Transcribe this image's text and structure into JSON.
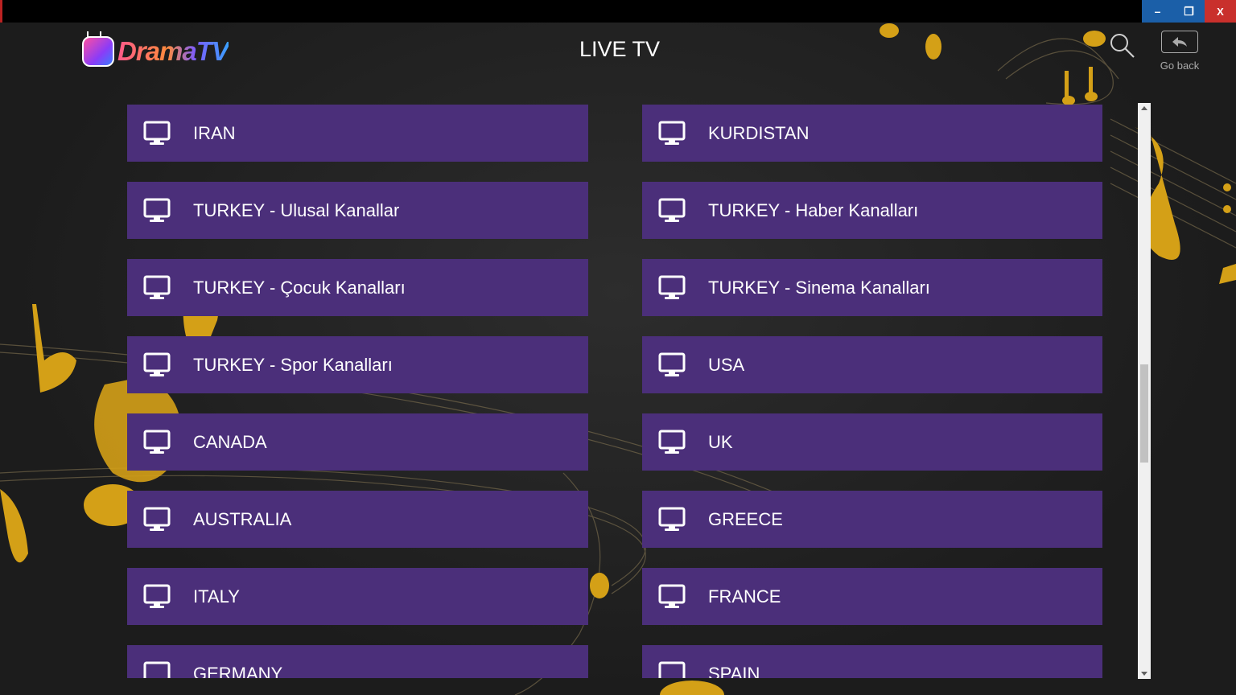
{
  "window": {
    "minimize_label": "–",
    "restore_label": "❐",
    "close_label": "X"
  },
  "header": {
    "logo_text": "DramaTV",
    "title": "LIVE TV",
    "search_icon": "search-icon",
    "back_label": "Go back"
  },
  "categories": [
    "IRAN",
    "KURDISTAN",
    "TURKEY - Ulusal Kanallar",
    "TURKEY - Haber Kanalları",
    "TURKEY - Çocuk Kanalları",
    "TURKEY - Sinema Kanalları",
    "TURKEY - Spor Kanalları",
    "USA",
    "CANADA",
    "UK",
    "AUSTRALIA",
    "GREECE",
    "ITALY",
    "FRANCE",
    "GERMANY",
    "SPAIN"
  ],
  "colors": {
    "tile": "#4b2f7a",
    "background": "#1f1f1f",
    "decor": "#d4a017"
  },
  "scroll": {
    "position_fraction": 0.55
  }
}
